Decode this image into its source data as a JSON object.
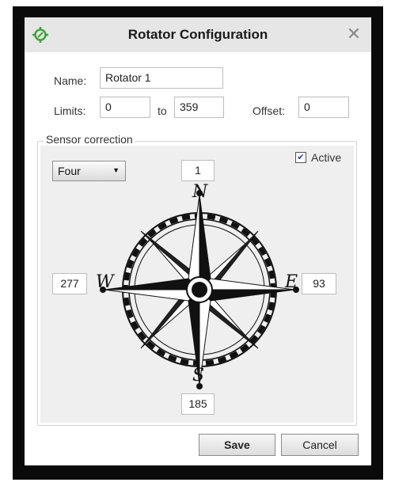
{
  "window": {
    "title": "Rotator Configuration",
    "close_glyph": "✕"
  },
  "form": {
    "name_label": "Name:",
    "name_value": "Rotator 1",
    "limits_label": "Limits:",
    "limit_min": "0",
    "to_label": "to",
    "limit_max": "359",
    "offset_label": "Offset:",
    "offset_value": "0"
  },
  "sensor": {
    "group_title": "Sensor correction",
    "mode": "Four",
    "active_label": "Active",
    "active_checked": true,
    "north_value": "1",
    "west_value": "277",
    "east_value": "93",
    "south_value": "185",
    "north_letter": "N",
    "south_letter": "S",
    "west_letter": "W",
    "east_letter": "E"
  },
  "buttons": {
    "save": "Save",
    "cancel": "Cancel"
  },
  "colors": {
    "titlebar": "#e6e6e6",
    "app_icon": "#3aa535",
    "group_bg": "#efefef"
  },
  "icons": {
    "app": "compass-crosshair-icon",
    "close": "close-icon",
    "dropdown": "chevron-down-icon",
    "checkbox": "checkmark-icon"
  }
}
